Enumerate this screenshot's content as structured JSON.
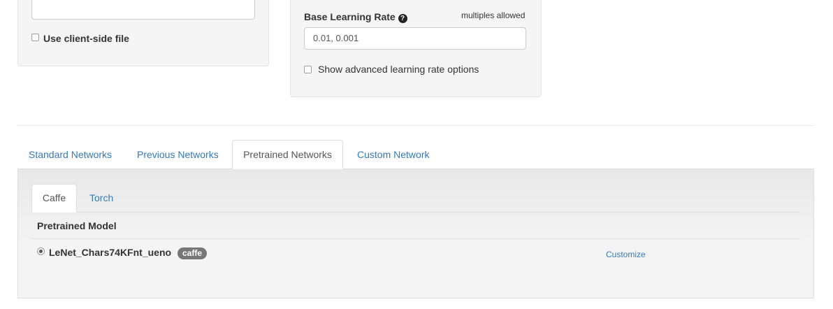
{
  "data_source": {
    "use_client_side_label": "Use client-side file"
  },
  "solver": {
    "lr_label": "Base Learning Rate",
    "lr_hint": "multiples allowed",
    "lr_value": "0.01, 0.001",
    "advanced_label": "Show advanced learning rate options"
  },
  "network_tabs": {
    "standard": "Standard Networks",
    "previous": "Previous Networks",
    "pretrained": "Pretrained Networks",
    "custom": "Custom Network"
  },
  "framework_tabs": {
    "caffe": "Caffe",
    "torch": "Torch"
  },
  "table": {
    "header": "Pretrained Model",
    "rows": [
      {
        "name": "LeNet_Chars74KFnt_ueno",
        "badge": "caffe",
        "action": "Customize",
        "selected": true
      }
    ]
  },
  "icons": {
    "help": "question-circle-icon"
  }
}
